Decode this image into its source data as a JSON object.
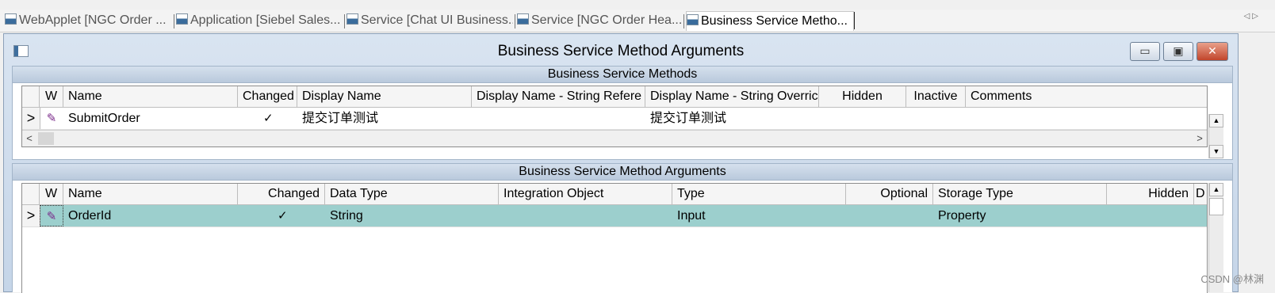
{
  "tabs": [
    {
      "label": "WebApplet [NGC Order ..."
    },
    {
      "label": "Application [Siebel Sales..."
    },
    {
      "label": "Service [Chat UI Business..."
    },
    {
      "label": "Service [NGC Order Hea..."
    },
    {
      "label": "Business Service Metho..."
    }
  ],
  "tab_nav": {
    "left": "◁",
    "right": "▷"
  },
  "window": {
    "title": "Business Service Method Arguments",
    "minimize": "▭",
    "maximize": "▣",
    "close": "✕"
  },
  "methods_panel": {
    "title": "Business Service Methods",
    "columns": [
      "W",
      "Name",
      "Changed",
      "Display Name",
      "Display Name - String Refere",
      "Display Name - String Overric",
      "Hidden",
      "Inactive",
      "Comments"
    ],
    "rows": [
      {
        "indicator": ">",
        "edit": "✎",
        "name": "SubmitOrder",
        "changed": "✓",
        "display_name": "提交订单测试",
        "display_name_override": "提交订单测试"
      }
    ],
    "hscroll": {
      "left": "<",
      "right": ">"
    }
  },
  "arguments_panel": {
    "title": "Business Service Method Arguments",
    "columns": [
      "W",
      "Name",
      "Changed",
      "Data Type",
      "Integration Object",
      "Type",
      "Optional",
      "Storage Type",
      "Hidden",
      "D"
    ],
    "rows": [
      {
        "indicator": ">",
        "edit": "✎",
        "name": "OrderId",
        "changed": "✓",
        "data_type": "String",
        "type": "Input",
        "storage_type": "Property"
      }
    ]
  },
  "scroll": {
    "up": "▲",
    "down": "▼"
  },
  "watermark": "CSDN @林渊"
}
